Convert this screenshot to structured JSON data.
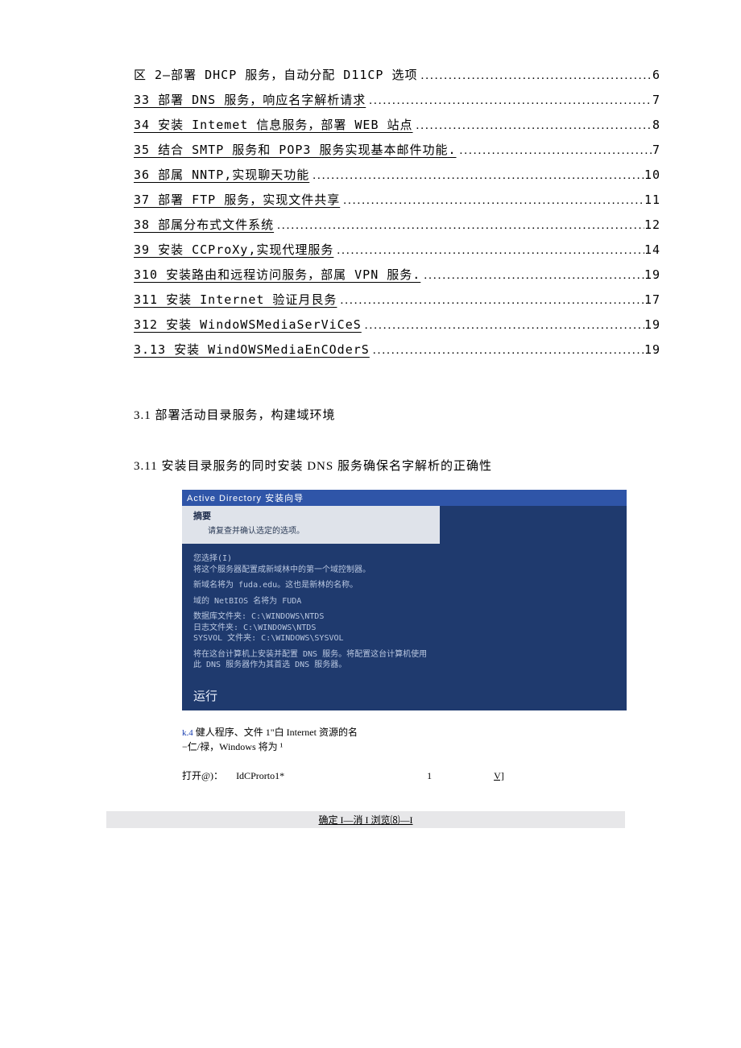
{
  "toc": [
    {
      "text": "区 2—部署 DHCP 服务，自动分配 D11CP 选项 ",
      "page": "6",
      "first": true
    },
    {
      "text": "33 部署 DNS 服务，响应名字解析请求 ",
      "page": "7"
    },
    {
      "text": "34 安装 Intemet 信息服务，部署 WEB 站点 ",
      "page": "8"
    },
    {
      "text": "35 结合 SMTP 服务和 POP3 服务实现基本邮件功能.",
      "page": "7"
    },
    {
      "text": "36 部属 NNTP,实现聊天功能 ",
      "page": "10"
    },
    {
      "text": "37 部署 FTP 服务，实现文件共享 ",
      "page": "11"
    },
    {
      "text": "38 部属分布式文件系统 ",
      "page": "12"
    },
    {
      "text": "39 安装 CCProXy,实现代理服务 ",
      "page": "14"
    },
    {
      "text": "310 安装路由和远程访问服务，部属 VPN 服务.",
      "page": "19"
    },
    {
      "text": "311 安装 Internet 验证月艮务 ",
      "page": "17"
    },
    {
      "text": "312 安装 WindoWSMediaSerViCeS ",
      "page": "19"
    },
    {
      "text": "3.13 安装 WindOWSMediaEnCOderS ",
      "page": "19"
    }
  ],
  "headings": {
    "h1": "3.1 部署活动目录服务，构建域环境",
    "h2": "3.11 安装目录服务的同时安装 DNS 服务确保名字解析的正确性"
  },
  "wizard": {
    "title": "Active Directory 安装向导",
    "summary_label": "摘要",
    "summary_sub": "请复查并确认选定的选项。",
    "choice_label": "您选择(I)",
    "choice_text": "将这个服务器配置成新域林中的第一个域控制器。",
    "newdomain": "新域名将为 fuda.edu。这也是新林的名称。",
    "netbios": "域的 NetBIOS 名将为 FUDA",
    "paths": "数据库文件夹: C:\\WINDOWS\\NTDS\n日志文件夹: C:\\WINDOWS\\NTDS\nSYSVOL 文件夹: C:\\WINDOWS\\SYSVOL",
    "dns": "将在这台计算机上安装并配置 DNS 服务。将配置这台计算机使用此 DNS 服务器作为其首选 DNS 服务器。",
    "run": "运行"
  },
  "run_dialog": {
    "line_prefix": "k.4",
    "line1_rest": " 健人程序、文件 1\"白 Internet 资源的名",
    "line2": "−仁/禄，Windows 将为 ¹",
    "open_label": "打开@)：",
    "open_value": "IdCProrto1*",
    "one": "1",
    "vj": "V]"
  },
  "buttons_bar": "确定 I—消 I 浏览⑻—I"
}
